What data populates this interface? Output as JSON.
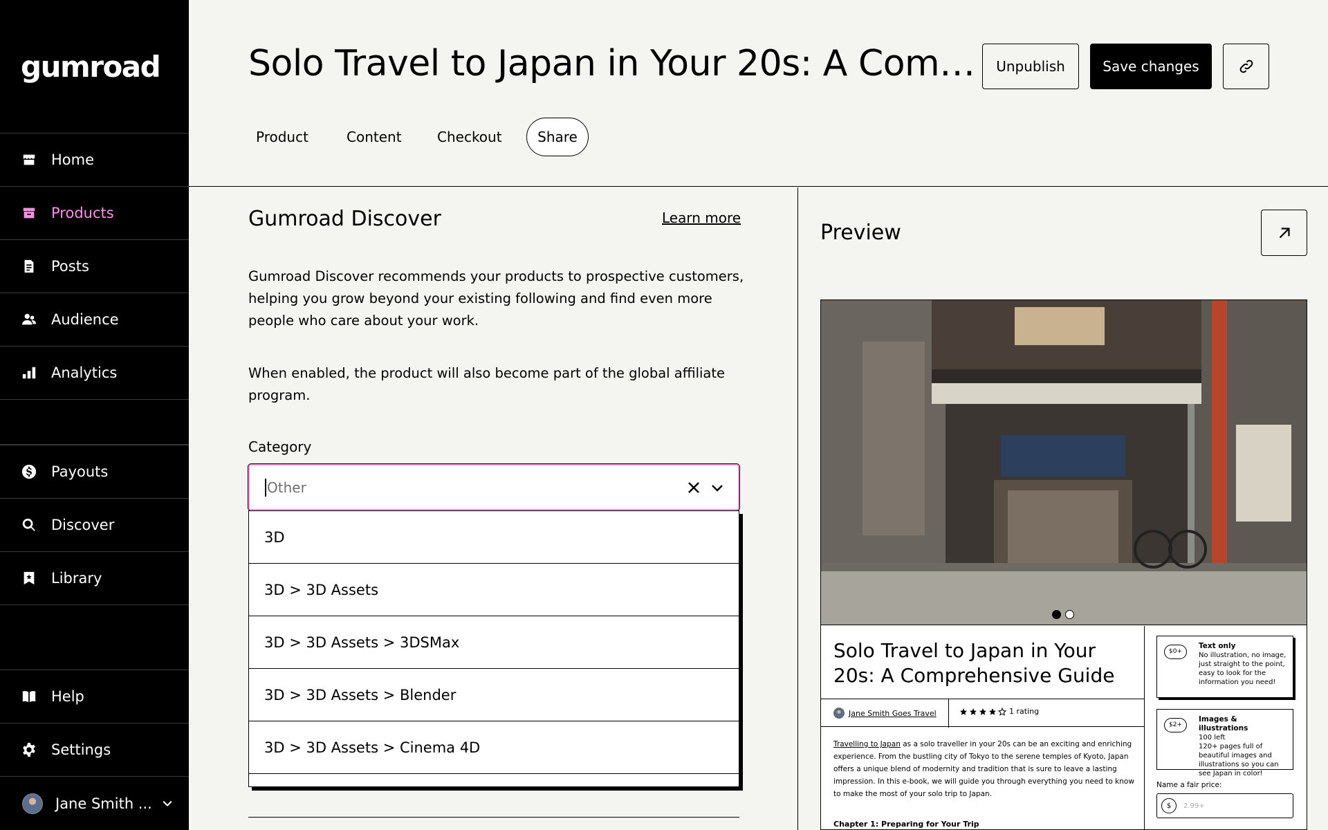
{
  "app": {
    "logo": "gumroad"
  },
  "sidebar": {
    "items": [
      {
        "label": "Home",
        "icon": "store-icon"
      },
      {
        "label": "Products",
        "icon": "archive-icon",
        "active": true
      },
      {
        "label": "Posts",
        "icon": "document-icon"
      },
      {
        "label": "Audience",
        "icon": "people-icon"
      },
      {
        "label": "Analytics",
        "icon": "bar-chart-icon"
      },
      {
        "label": "Payouts",
        "icon": "dollar-circle-icon"
      },
      {
        "label": "Discover",
        "icon": "search-icon"
      },
      {
        "label": "Library",
        "icon": "bookmark-icon"
      },
      {
        "label": "Help",
        "icon": "book-icon"
      },
      {
        "label": "Settings",
        "icon": "gear-icon"
      }
    ],
    "user": {
      "name": "Jane Smith ..."
    },
    "active_color": "#ff90e8"
  },
  "header": {
    "title": "Solo Travel to Japan in Your 20s: A Comprehensive Guide",
    "unpublish_label": "Unpublish",
    "save_label": "Save changes",
    "tabs": [
      {
        "label": "Product"
      },
      {
        "label": "Content"
      },
      {
        "label": "Checkout"
      },
      {
        "label": "Share",
        "active": true
      }
    ]
  },
  "discover": {
    "title": "Gumroad Discover",
    "learn_more": "Learn more",
    "paragraph1": "Gumroad Discover recommends your products to prospective customers, helping you grow beyond your existing following and find even more people who care about your work.",
    "paragraph2": "When enabled, the product will also become part of the global affiliate program.",
    "category_label": "Category",
    "category_placeholder": "Other",
    "options": [
      "3D",
      "3D > 3D Assets",
      "3D > 3D Assets > 3DSMax",
      "3D > 3D Assets > Blender",
      "3D > 3D Assets > Cinema 4D"
    ]
  },
  "preview": {
    "title": "Preview",
    "product_title": "Solo Travel to Japan in Your 20s: A Comprehensive Guide",
    "author": "Jane Smith Goes Travel",
    "rating_text": "1 rating",
    "rating": 4,
    "description_link": "Travelling to Japan",
    "description_rest": " as a solo traveller in your 20s can be an exciting and enriching experience. From the bustling city of Tokyo to the serene temples of Kyoto, Japan offers a unique blend of modernity and tradition that is sure to leave a lasting impression. In this e-book, we will guide you through everything you need to know to make the most of your solo trip to Japan.",
    "chapter": "Chapter 1: Preparing for Your Trip",
    "image_count": 2,
    "active_image": 1,
    "tiers": [
      {
        "price": "$0+",
        "name": "Text only",
        "desc": "No illustration, no image, just straight to the point, easy to look for the information you need!"
      },
      {
        "price": "$2+",
        "name": "Images & illustrations",
        "left": "100 left",
        "desc": "120+ pages full of beautiful images and illustrations so you can see Japan in color!"
      }
    ],
    "fair_price_label": "Name a fair price:",
    "currency": "$",
    "fair_price_placeholder": "2.99+"
  }
}
